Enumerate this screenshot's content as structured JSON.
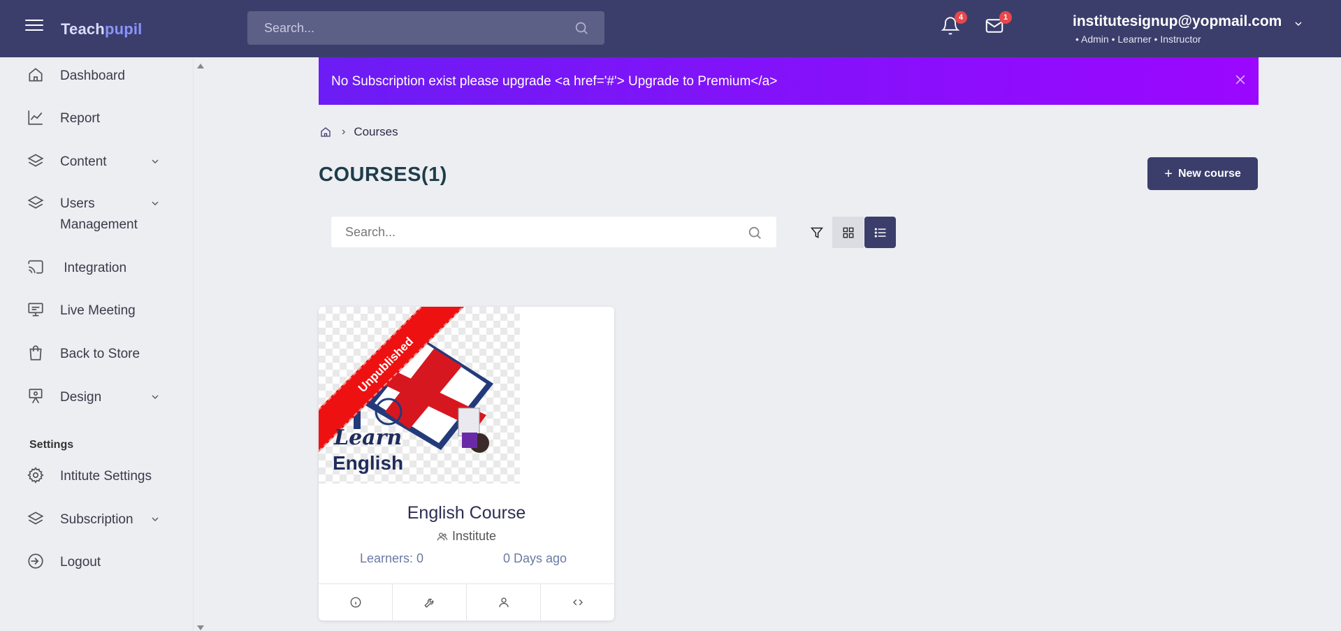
{
  "header": {
    "logo_main": "Teach",
    "logo_accent": "pupil",
    "search_placeholder": "Search...",
    "notifications_count": "4",
    "messages_count": "1",
    "user_email": "institutesignup@yopmail.com",
    "user_roles": "• Admin • Learner • Instructor"
  },
  "sidebar": {
    "items": [
      {
        "label": "Dashboard",
        "icon": "home-icon"
      },
      {
        "label": "Report",
        "icon": "chart-line-icon"
      },
      {
        "label": "Content",
        "icon": "layers-icon",
        "has_submenu": true
      },
      {
        "label": "Users Management",
        "icon": "layers-icon",
        "has_submenu": true
      },
      {
        "label": " Integration",
        "icon": "cast-icon"
      },
      {
        "label": "Live Meeting",
        "icon": "presentation-icon"
      },
      {
        "label": "Back to Store",
        "icon": "shopping-bag-icon"
      },
      {
        "label": "Design",
        "icon": "easel-icon",
        "has_submenu": true
      }
    ],
    "settings_heading": "Settings",
    "settings_items": [
      {
        "label": "Intitute Settings",
        "icon": "gear-icon"
      },
      {
        "label": "Subscription",
        "icon": "layers-icon",
        "has_submenu": true
      },
      {
        "label": "Logout",
        "icon": "logout-icon"
      }
    ]
  },
  "alert": {
    "text": "No Subscription exist please upgrade <a href='#'> Upgrade to Premium</a>",
    "color_start": "#6c1cf4",
    "color_end": "#9b07ff"
  },
  "breadcrumb": {
    "current": "Courses"
  },
  "page": {
    "title": "COURSES(1)",
    "new_course_label": "New course",
    "search_placeholder": "Search..."
  },
  "courses": [
    {
      "title": "English Course",
      "status_ribbon": "Unpublished",
      "thumbnail_text_1": "Learn",
      "thumbnail_text_2": "English",
      "owner": "Institute",
      "learners": "Learners: 0",
      "age": "0 Days ago"
    }
  ],
  "colors": {
    "primary": "#3b3e6b",
    "ribbon": "#ee1111",
    "badge": "#e8474b"
  }
}
